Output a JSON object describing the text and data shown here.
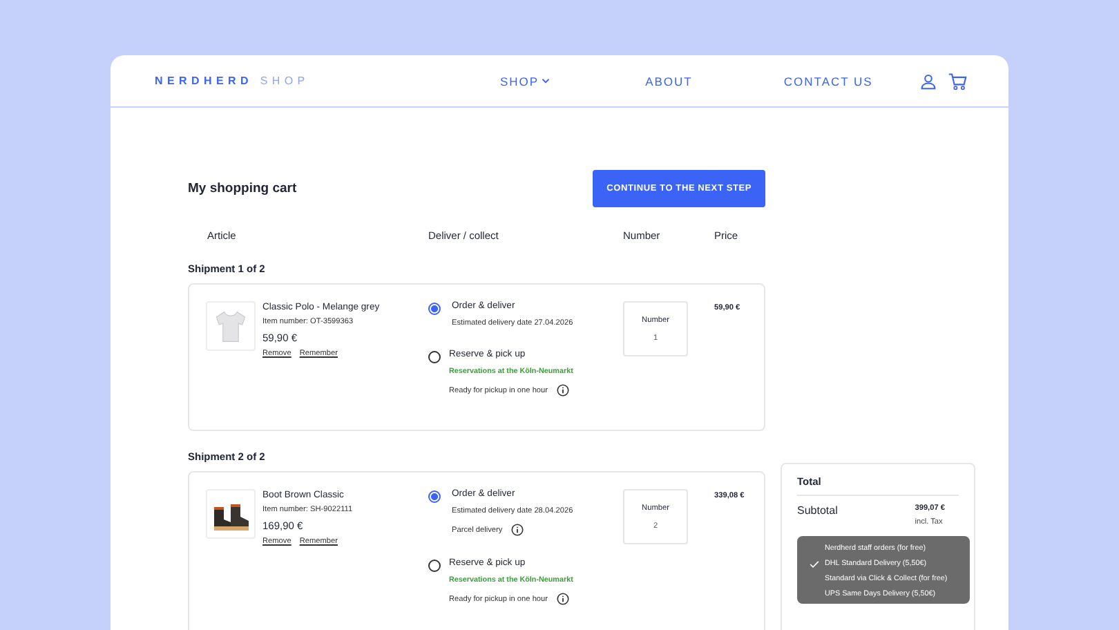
{
  "brand": {
    "name": "NERDHERD",
    "suffix": "SHOP"
  },
  "nav": [
    {
      "label": "SHOP",
      "dropdown": true
    },
    {
      "label": "ABOUT",
      "dropdown": false
    },
    {
      "label": "CONTACT US",
      "dropdown": false
    }
  ],
  "cart": {
    "title": "My shopping cart",
    "button": "CONTINUE TO THE NEXT STEP",
    "columns": [
      "Article",
      "Deliver / collect",
      "Number",
      "Price"
    ],
    "shipments": [
      {
        "heading": "Shipment 1 of 2",
        "product": {
          "name": "Classic Polo - Melange grey",
          "item_number": "Item number: OT-3599363",
          "price": "59,90 €",
          "kind": "shirt",
          "actions": [
            "Remove",
            "Remember"
          ]
        },
        "options": [
          {
            "title": "Order & deliver",
            "selected": true,
            "lines": [
              {
                "kind": "note",
                "text": "Estimated delivery date 27.04.2026"
              }
            ]
          },
          {
            "title": "Reserve & pick up",
            "selected": false,
            "lines": [
              {
                "kind": "store",
                "text": "Reservations at the Köln-Neumarkt"
              },
              {
                "kind": "info",
                "text": "Ready for pickup in one hour"
              }
            ]
          }
        ],
        "number": {
          "label": "Number",
          "value": "1"
        },
        "total": "59,90 €"
      },
      {
        "heading": "Shipment 2 of 2",
        "product": {
          "name": "Boot Brown Classic",
          "item_number": "Item number: SH-9022111",
          "price": "169,90 €",
          "kind": "boot",
          "actions": [
            "Remove",
            "Remember"
          ]
        },
        "options": [
          {
            "title": "Order & deliver",
            "selected": true,
            "lines": [
              {
                "kind": "note",
                "text": "Estimated delivery date 28.04.2026"
              },
              {
                "kind": "info",
                "text": "Parcel delivery"
              }
            ]
          },
          {
            "title": "Reserve & pick up",
            "selected": false,
            "lines": [
              {
                "kind": "store",
                "text": "Reservations at the Köln-Neumarkt"
              },
              {
                "kind": "info",
                "text": "Ready for pickup in one hour"
              }
            ]
          }
        ],
        "number": {
          "label": "Number",
          "value": "2"
        },
        "total": "339,08 €"
      }
    ]
  },
  "summary": {
    "title": "Total",
    "subtotal_label": "Subtotal",
    "subtotal": "399,07 €",
    "tax": "incl. Tax",
    "shipping_menu": [
      {
        "label": "Nerdherd staff orders (for free)",
        "selected": false
      },
      {
        "label": "DHL Standard Delivery (5,50€)",
        "selected": true
      },
      {
        "label": "Standard via Click & Collect (for free)",
        "selected": false
      },
      {
        "label": "UPS Same Days Delivery (5,50€)",
        "selected": false
      }
    ]
  }
}
